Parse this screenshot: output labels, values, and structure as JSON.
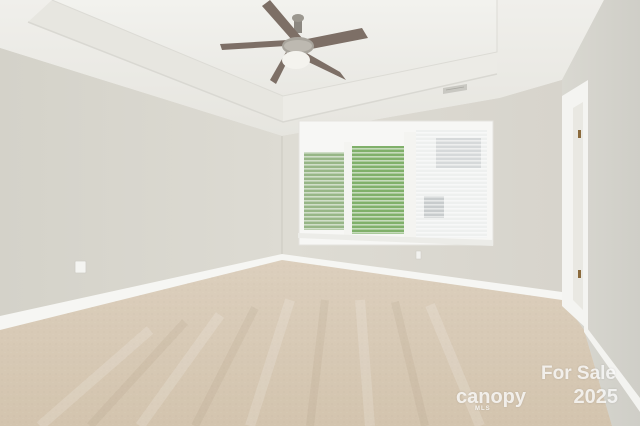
{
  "watermark": {
    "tag": "For Sale",
    "brand": "canopy",
    "year": "2025",
    "sub": "MLS"
  },
  "colors": {
    "wall": "#dad8d0",
    "ceiling": "#eeede8",
    "carpet": "#d6c8b4",
    "trim": "#f5f5f2",
    "foliage": "#5a9a3c"
  },
  "icons": [
    "ceiling-fan",
    "outlet",
    "air-vent",
    "door-hinge"
  ]
}
